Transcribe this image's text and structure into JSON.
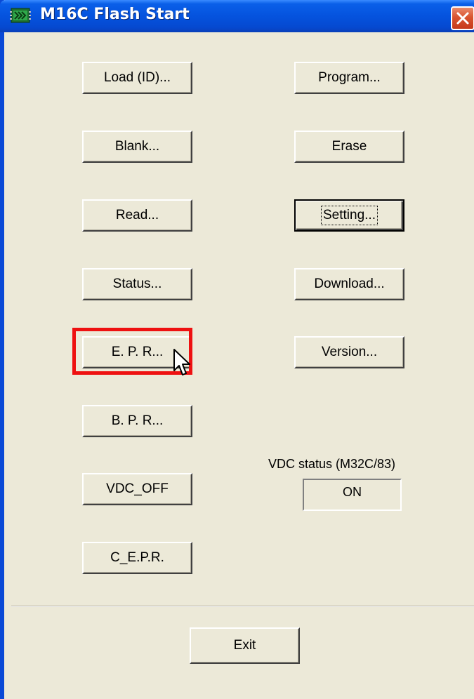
{
  "window": {
    "title": "M16C Flash Start"
  },
  "buttons": {
    "load_id": "Load (ID)...",
    "blank": "Blank...",
    "read": "Read...",
    "status": "Status...",
    "epr": "E. P. R...",
    "bpr": "B. P. R...",
    "vdc_off": "VDC_OFF",
    "cepr": "C_E.P.R.",
    "program": "Program...",
    "erase": "Erase",
    "setting": "Setting...",
    "download": "Download...",
    "version": "Version...",
    "exit": "Exit"
  },
  "vdc": {
    "label": "VDC status (M32C/83)",
    "value": "ON"
  },
  "icons": {
    "app": "app-chip-icon",
    "close": "close-icon",
    "cursor": "mouse-pointer-icon"
  },
  "colors": {
    "titlebar": "#0553DE",
    "window_bg": "#ECE9D8",
    "highlight": "#EE1111",
    "close_button": "#D9542F"
  }
}
